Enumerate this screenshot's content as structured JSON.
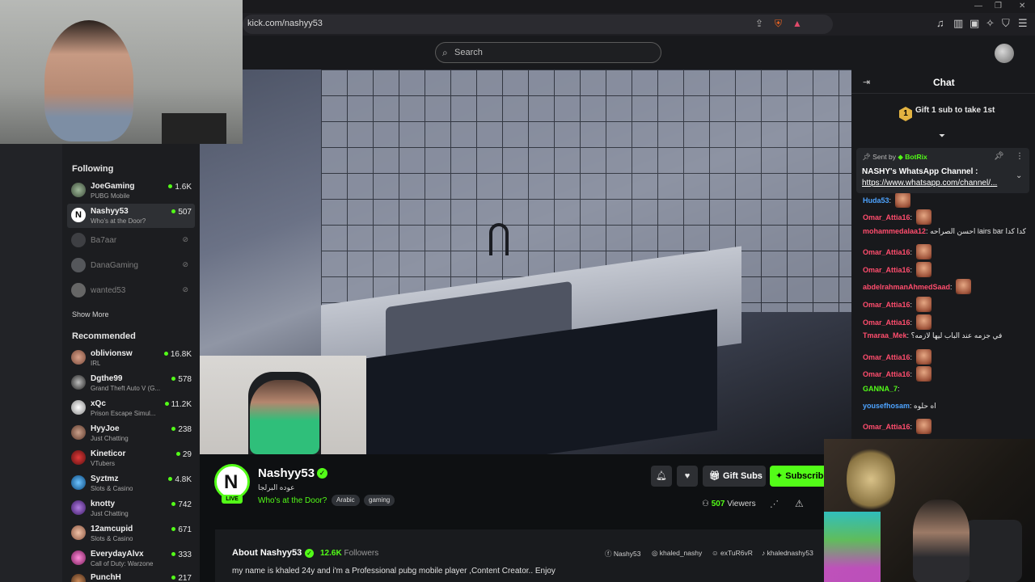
{
  "browser": {
    "url": "kick.com/nashyy53"
  },
  "header": {
    "search_placeholder": "Search"
  },
  "sidebar": {
    "following_title": "Following",
    "following": [
      {
        "name": "JoeGaming",
        "category": "PUBG Mobile",
        "viewers": "1.6K",
        "live": true
      },
      {
        "name": "Nashyy53",
        "category": "Who's at the Door?",
        "viewers": "507",
        "live": true
      },
      {
        "name": "Ba7aar",
        "live": false
      },
      {
        "name": "DanaGaming",
        "live": false
      },
      {
        "name": "wanted53",
        "live": false
      }
    ],
    "show_more": "Show More",
    "recommended_title": "Recommended",
    "recommended": [
      {
        "name": "oblivionsw",
        "category": "IRL",
        "viewers": "16.8K"
      },
      {
        "name": "Dgthe99",
        "category": "Grand Theft Auto V (G...",
        "viewers": "578"
      },
      {
        "name": "xQc",
        "category": "Prison Escape Simul...",
        "viewers": "11.2K"
      },
      {
        "name": "HyyJoe",
        "category": "Just Chatting",
        "viewers": "238"
      },
      {
        "name": "Kineticor",
        "category": "VTubers",
        "viewers": "29"
      },
      {
        "name": "Syztmz",
        "category": "Slots & Casino",
        "viewers": "4.8K"
      },
      {
        "name": "knotty",
        "category": "Just Chatting",
        "viewers": "742"
      },
      {
        "name": "12amcupid",
        "category": "Slots & Casino",
        "viewers": "671"
      },
      {
        "name": "EverydayAlvx",
        "category": "Call of Duty: Warzone",
        "viewers": "333"
      },
      {
        "name": "PunchH",
        "category": "",
        "viewers": "217"
      }
    ]
  },
  "stream": {
    "avatar_letter": "N",
    "live_label": "LIVE",
    "name": "Nashyy53",
    "subtitle": "عوده البرلجا",
    "title": "Who's at the Door?",
    "tags": [
      "Arabic",
      "gaming"
    ],
    "gift_subs_label": "Gift Subs",
    "subscribe_label": "Subscribe",
    "viewers_count": "507",
    "viewers_label": "Viewers"
  },
  "about": {
    "title": "About Nashyy53",
    "followers_count": "12.6K",
    "followers_label": "Followers",
    "bio": "my name is khaled 24y and i'm a Professional pubg mobile player ,Content Creator.. Enjoy",
    "socials": [
      "Nashy53",
      "khaled_nashy",
      "exTuR6vR",
      "khalednashy53"
    ]
  },
  "chat": {
    "title": "Chat",
    "gift_medal": "1",
    "gift_prompt": "Gift 1 sub to take 1st",
    "pinned": {
      "sent_by_label": "Sent by",
      "sender": "BotRix",
      "line1": "NASHY's WhatsApp Channel :",
      "line2": "https://www.whatsapp.com/channel/..."
    },
    "messages": [
      {
        "user": "Huda53",
        "color": "#4da3ff",
        "text": "",
        "emote": true
      },
      {
        "user": "Omar_Attia16",
        "color": "#ff4d6d",
        "text": "",
        "emote": true
      },
      {
        "user": "mohammedalaa12",
        "color": "#ff4d6d",
        "text": "احسن الصراحه lairs bar كدا كدا",
        "emote": false
      },
      {
        "user": "Omar_Attia16",
        "color": "#ff4d6d",
        "text": "",
        "emote": true
      },
      {
        "user": "Omar_Attia16",
        "color": "#ff4d6d",
        "text": "",
        "emote": true
      },
      {
        "user": "abdelrahmanAhmedSaad",
        "color": "#ff4d6d",
        "text": "",
        "emote": true
      },
      {
        "user": "Omar_Attia16",
        "color": "#ff4d6d",
        "text": "",
        "emote": true
      },
      {
        "user": "Omar_Attia16",
        "color": "#ff4d6d",
        "text": "",
        "emote": true
      },
      {
        "user": "Tmaraa_Mek",
        "color": "#ff4d6d",
        "text": "في جزمه عند الباب ليها لازمه؟",
        "emote": false
      },
      {
        "user": "Omar_Attia16",
        "color": "#ff4d6d",
        "text": "",
        "emote": true
      },
      {
        "user": "Omar_Attia16",
        "color": "#ff4d6d",
        "text": "",
        "emote": true
      },
      {
        "user": "GANNA_7",
        "color": "#53fc18",
        "text": "",
        "emote": false
      },
      {
        "user": "yousefhosam",
        "color": "#4da3ff",
        "text": "اه حلوه",
        "emote": false
      },
      {
        "user": "Omar_Attia16",
        "color": "#ff4d6d",
        "text": "",
        "emote": true
      }
    ]
  },
  "colors": {
    "accent": "#53fc18",
    "background": "#0b0e0f",
    "sidebar": "#1c1d20"
  }
}
